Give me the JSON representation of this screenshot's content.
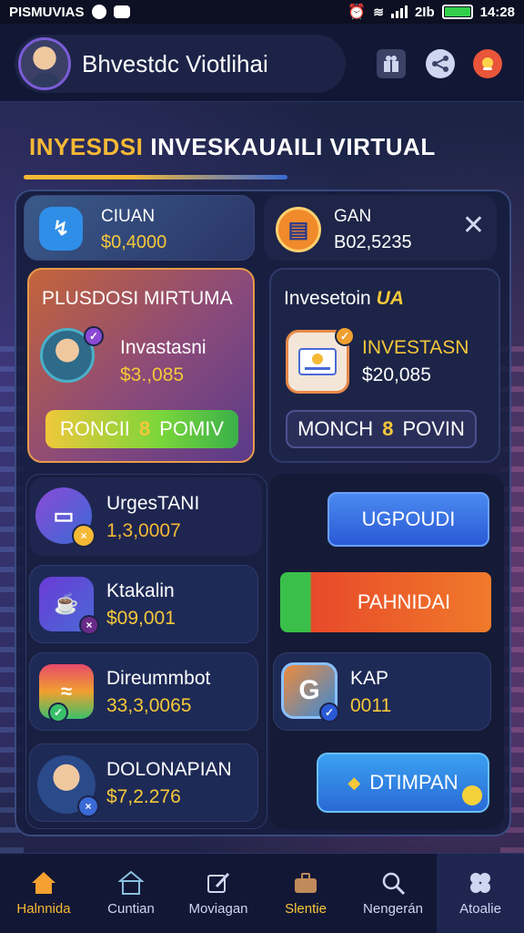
{
  "status_bar": {
    "carrier": "PISMUVIAS",
    "time": "14:28",
    "status_mark": "2Ib"
  },
  "header": {
    "profile_name": "Bhvestdc Viotlihai",
    "icons": [
      "gift-icon",
      "share-icon",
      "notification-icon"
    ]
  },
  "section": {
    "title_accent": "INYESDSI",
    "title_main": "INVESKAUAILI VIRTUAL"
  },
  "top_cards": [
    {
      "name": "CIUAN",
      "value": "$0,4000",
      "icon": "chart-icon"
    },
    {
      "name": "GAN",
      "value": "B02,5235",
      "icon": "briefcase-icon"
    }
  ],
  "featured": [
    {
      "title": "PLUSDOSI MIRTUMA",
      "name": "Invastasni",
      "value": "$3.,085",
      "button_text": "RONCII",
      "button_amp": "8",
      "button_text2": "POMIV"
    },
    {
      "title": "Invesetoin",
      "title_tag": "UA",
      "name": "INVESTASN",
      "value": "$20,085",
      "button_text": "MONCH",
      "button_amp": "8",
      "button_text2": "POVIN"
    }
  ],
  "list_left": [
    {
      "name": "UrgesTANI",
      "value": "1,3,0007",
      "icon": "monitor-icon"
    },
    {
      "name": "Ktakalin",
      "value": "$09,001",
      "icon": "cup-icon"
    },
    {
      "name": "Direummbot",
      "value": "33,3,0065",
      "icon": "wave-icon"
    },
    {
      "name": "DOLONAPIAN",
      "value": "$7,2.276",
      "icon": "person-icon"
    }
  ],
  "right_actions": {
    "btn1": "UGPOUDI",
    "btn2": "PAHNIDAI",
    "kap": {
      "name": "KAP",
      "value": "0011",
      "icon": "app-g-icon"
    },
    "btn3": "DTIMPAN"
  },
  "bottom_nav": [
    {
      "label": "Halnnida",
      "icon": "home-icon"
    },
    {
      "label": "Cuntian",
      "icon": "building-icon"
    },
    {
      "label": "Moviagan",
      "icon": "edit-icon"
    },
    {
      "label": "Slentie",
      "icon": "briefcase-icon"
    },
    {
      "label": "Nengerán",
      "icon": "search-icon"
    },
    {
      "label": "Atoalie",
      "icon": "clover-icon"
    }
  ],
  "colors": {
    "accent": "#f5b935",
    "value_gold": "#f5c83a",
    "panel_bg": "#141c3c"
  }
}
